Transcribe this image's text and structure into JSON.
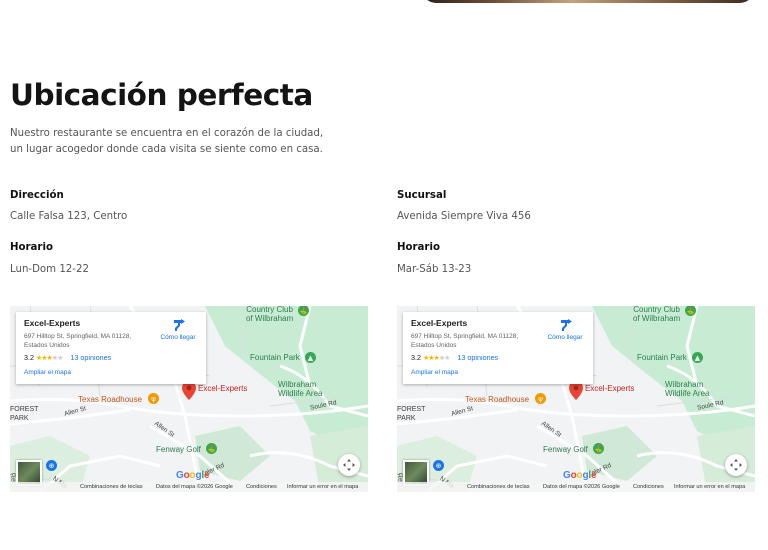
{
  "section": {
    "title": "Ubicación perfecta",
    "intro_line1": "Nuestro restaurante se encuentra en el corazón de la ciudad,",
    "intro_line2": "un lugar acogedor donde cada visita se siente como en casa."
  },
  "locations": [
    {
      "address_label": "Dirección",
      "address": "Calle Falsa 123, Centro",
      "hours_label": "Horario",
      "hours": "Lun-Dom 12-22"
    },
    {
      "address_label": "Sucursal",
      "address": "Avenida Siempre Viva 456",
      "hours_label": "Horario",
      "hours": "Mar-Sáb 13-23"
    }
  ],
  "map": {
    "place_name": "Excel-Experts",
    "address_line1": "697 Hilltop St, Springfield, MA 01128,",
    "address_line2": "Estados Unidos",
    "rating": "3.2",
    "stars_filled": 3,
    "stars_total": 5,
    "reviews": "13 opiniones",
    "directions": "Cómo llegar",
    "enlarge": "Ampliar el mapa",
    "labels": {
      "country_club_1": "Country Club",
      "country_club_2": "of Wilbraham",
      "fountain_park": "Fountain Park",
      "wilbraham_1": "Wilbraham",
      "wilbraham_2": "Wildlife Area",
      "pin_label": "Excel-Experts",
      "texas": "Texas Roadhouse",
      "fenway": "Fenway Golf",
      "forest": "FOREST",
      "park": "PARK",
      "allen_st_1": "Allen St",
      "allen_st_2": "Allen St",
      "soule_rd": "Soule Rd",
      "glen_rd": "gler Rd",
      "n_ma": "N Ma",
      "left_edge": "Re"
    },
    "footer": {
      "shortcuts": "Combinaciones de teclas",
      "data": "Datos del mapa ©2026 Google",
      "terms": "Condiciones",
      "report": "Informar un error en el mapa"
    },
    "google": [
      "G",
      "o",
      "o",
      "g",
      "l",
      "e"
    ],
    "colors": {
      "park_green": "#c8ecd3",
      "road": "#ffffff",
      "pin_red": "#ea4335",
      "link_blue": "#1a73e8"
    }
  }
}
